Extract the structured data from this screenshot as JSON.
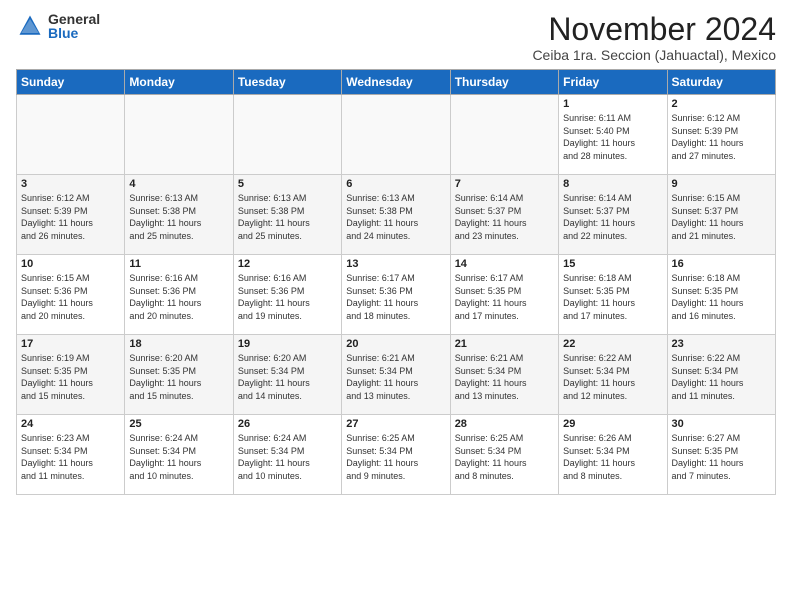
{
  "logo": {
    "general": "General",
    "blue": "Blue"
  },
  "title": "November 2024",
  "subtitle": "Ceiba 1ra. Seccion (Jahuactal), Mexico",
  "days_header": [
    "Sunday",
    "Monday",
    "Tuesday",
    "Wednesday",
    "Thursday",
    "Friday",
    "Saturday"
  ],
  "weeks": [
    [
      {
        "day": "",
        "info": ""
      },
      {
        "day": "",
        "info": ""
      },
      {
        "day": "",
        "info": ""
      },
      {
        "day": "",
        "info": ""
      },
      {
        "day": "",
        "info": ""
      },
      {
        "day": "1",
        "info": "Sunrise: 6:11 AM\nSunset: 5:40 PM\nDaylight: 11 hours\nand 28 minutes."
      },
      {
        "day": "2",
        "info": "Sunrise: 6:12 AM\nSunset: 5:39 PM\nDaylight: 11 hours\nand 27 minutes."
      }
    ],
    [
      {
        "day": "3",
        "info": "Sunrise: 6:12 AM\nSunset: 5:39 PM\nDaylight: 11 hours\nand 26 minutes."
      },
      {
        "day": "4",
        "info": "Sunrise: 6:13 AM\nSunset: 5:38 PM\nDaylight: 11 hours\nand 25 minutes."
      },
      {
        "day": "5",
        "info": "Sunrise: 6:13 AM\nSunset: 5:38 PM\nDaylight: 11 hours\nand 25 minutes."
      },
      {
        "day": "6",
        "info": "Sunrise: 6:13 AM\nSunset: 5:38 PM\nDaylight: 11 hours\nand 24 minutes."
      },
      {
        "day": "7",
        "info": "Sunrise: 6:14 AM\nSunset: 5:37 PM\nDaylight: 11 hours\nand 23 minutes."
      },
      {
        "day": "8",
        "info": "Sunrise: 6:14 AM\nSunset: 5:37 PM\nDaylight: 11 hours\nand 22 minutes."
      },
      {
        "day": "9",
        "info": "Sunrise: 6:15 AM\nSunset: 5:37 PM\nDaylight: 11 hours\nand 21 minutes."
      }
    ],
    [
      {
        "day": "10",
        "info": "Sunrise: 6:15 AM\nSunset: 5:36 PM\nDaylight: 11 hours\nand 20 minutes."
      },
      {
        "day": "11",
        "info": "Sunrise: 6:16 AM\nSunset: 5:36 PM\nDaylight: 11 hours\nand 20 minutes."
      },
      {
        "day": "12",
        "info": "Sunrise: 6:16 AM\nSunset: 5:36 PM\nDaylight: 11 hours\nand 19 minutes."
      },
      {
        "day": "13",
        "info": "Sunrise: 6:17 AM\nSunset: 5:36 PM\nDaylight: 11 hours\nand 18 minutes."
      },
      {
        "day": "14",
        "info": "Sunrise: 6:17 AM\nSunset: 5:35 PM\nDaylight: 11 hours\nand 17 minutes."
      },
      {
        "day": "15",
        "info": "Sunrise: 6:18 AM\nSunset: 5:35 PM\nDaylight: 11 hours\nand 17 minutes."
      },
      {
        "day": "16",
        "info": "Sunrise: 6:18 AM\nSunset: 5:35 PM\nDaylight: 11 hours\nand 16 minutes."
      }
    ],
    [
      {
        "day": "17",
        "info": "Sunrise: 6:19 AM\nSunset: 5:35 PM\nDaylight: 11 hours\nand 15 minutes."
      },
      {
        "day": "18",
        "info": "Sunrise: 6:20 AM\nSunset: 5:35 PM\nDaylight: 11 hours\nand 15 minutes."
      },
      {
        "day": "19",
        "info": "Sunrise: 6:20 AM\nSunset: 5:34 PM\nDaylight: 11 hours\nand 14 minutes."
      },
      {
        "day": "20",
        "info": "Sunrise: 6:21 AM\nSunset: 5:34 PM\nDaylight: 11 hours\nand 13 minutes."
      },
      {
        "day": "21",
        "info": "Sunrise: 6:21 AM\nSunset: 5:34 PM\nDaylight: 11 hours\nand 13 minutes."
      },
      {
        "day": "22",
        "info": "Sunrise: 6:22 AM\nSunset: 5:34 PM\nDaylight: 11 hours\nand 12 minutes."
      },
      {
        "day": "23",
        "info": "Sunrise: 6:22 AM\nSunset: 5:34 PM\nDaylight: 11 hours\nand 11 minutes."
      }
    ],
    [
      {
        "day": "24",
        "info": "Sunrise: 6:23 AM\nSunset: 5:34 PM\nDaylight: 11 hours\nand 11 minutes."
      },
      {
        "day": "25",
        "info": "Sunrise: 6:24 AM\nSunset: 5:34 PM\nDaylight: 11 hours\nand 10 minutes."
      },
      {
        "day": "26",
        "info": "Sunrise: 6:24 AM\nSunset: 5:34 PM\nDaylight: 11 hours\nand 10 minutes."
      },
      {
        "day": "27",
        "info": "Sunrise: 6:25 AM\nSunset: 5:34 PM\nDaylight: 11 hours\nand 9 minutes."
      },
      {
        "day": "28",
        "info": "Sunrise: 6:25 AM\nSunset: 5:34 PM\nDaylight: 11 hours\nand 8 minutes."
      },
      {
        "day": "29",
        "info": "Sunrise: 6:26 AM\nSunset: 5:34 PM\nDaylight: 11 hours\nand 8 minutes."
      },
      {
        "day": "30",
        "info": "Sunrise: 6:27 AM\nSunset: 5:35 PM\nDaylight: 11 hours\nand 7 minutes."
      }
    ]
  ]
}
